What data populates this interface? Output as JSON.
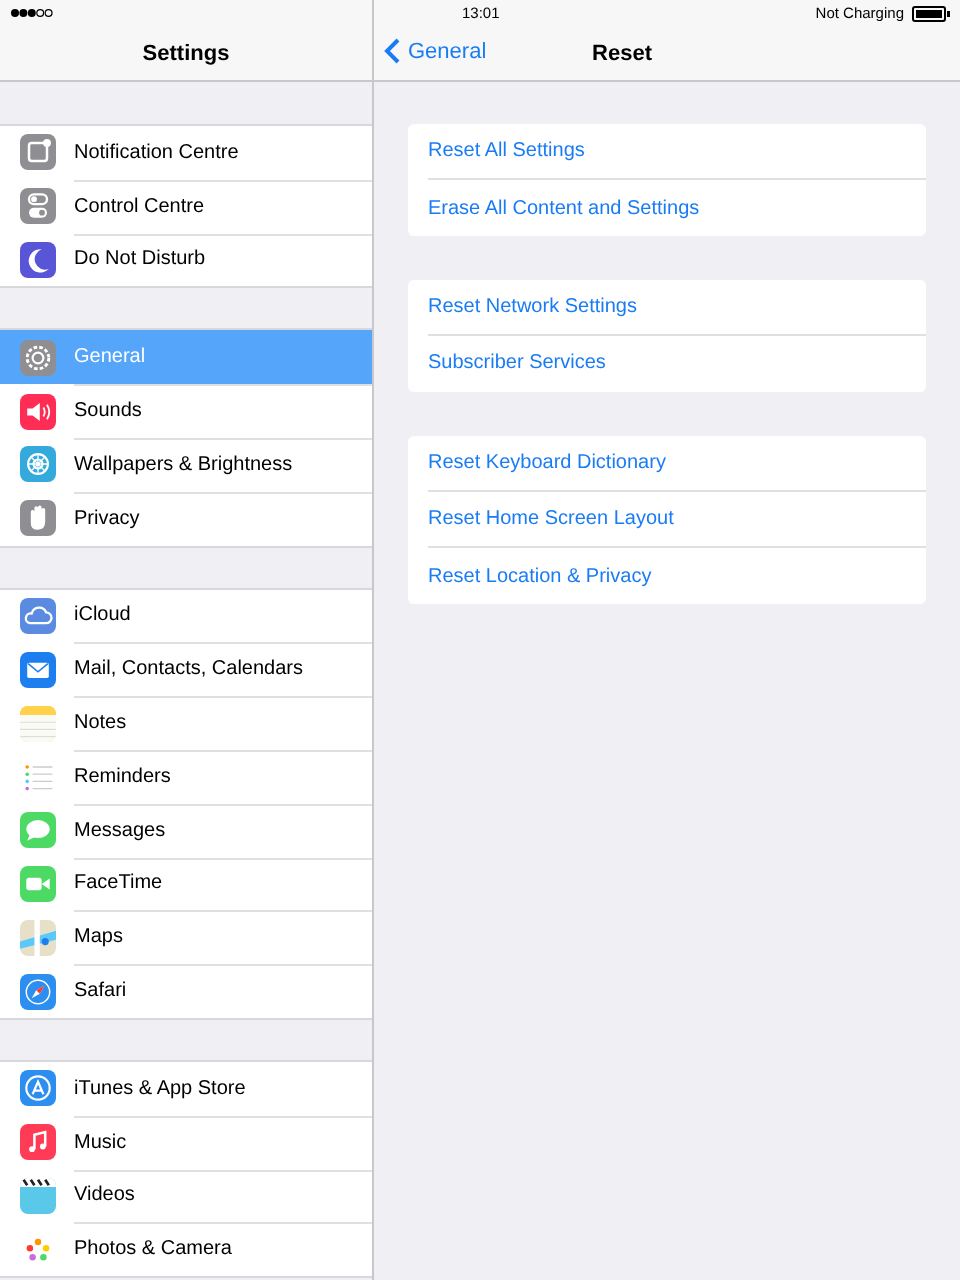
{
  "status_bar": {
    "time": "13:01",
    "battery_text": "Not Charging"
  },
  "sidebar": {
    "title": "Settings",
    "groups": [
      [
        {
          "label": "Notification Centre",
          "color": "#8e8e93",
          "selected": false
        },
        {
          "label": "Control Centre",
          "color": "#8e8e93",
          "selected": false
        },
        {
          "label": "Do Not Disturb",
          "color": "#5856d6",
          "selected": false
        }
      ],
      [
        {
          "label": "General",
          "color": "#8e8e93",
          "selected": true
        },
        {
          "label": "Sounds",
          "color": "#ff2d55",
          "selected": false
        },
        {
          "label": "Wallpapers & Brightness",
          "color": "#34aadc",
          "selected": false
        },
        {
          "label": "Privacy",
          "color": "#8e8e93",
          "selected": false
        }
      ],
      [
        {
          "label": "iCloud",
          "color": "#5a8be0",
          "selected": false
        },
        {
          "label": "Mail, Contacts, Calendars",
          "color": "#1d7ef0",
          "selected": false
        },
        {
          "label": "Notes",
          "color": "#ffd24a",
          "selected": false
        },
        {
          "label": "Reminders",
          "color": "#ffffff",
          "selected": false
        },
        {
          "label": "Messages",
          "color": "#4cd964",
          "selected": false
        },
        {
          "label": "FaceTime",
          "color": "#4cd964",
          "selected": false
        },
        {
          "label": "Maps",
          "color": "#e6e0c8",
          "selected": false
        },
        {
          "label": "Safari",
          "color": "#2c8ff0",
          "selected": false
        }
      ],
      [
        {
          "label": "iTunes & App Store",
          "color": "#2c8ff0",
          "selected": false
        },
        {
          "label": "Music",
          "color": "#ff3b55",
          "selected": false
        },
        {
          "label": "Videos",
          "color": "#5ac8e8",
          "selected": false
        },
        {
          "label": "Photos & Camera",
          "color": "#ffffff",
          "selected": false
        }
      ]
    ]
  },
  "detail": {
    "back": "General",
    "title": "Reset",
    "groups": [
      [
        "Reset All Settings",
        "Erase All Content and Settings"
      ],
      [
        "Reset Network Settings",
        "Subscriber Services"
      ],
      [
        "Reset Keyboard Dictionary",
        "Reset Home Screen Layout",
        "Reset Location & Privacy"
      ]
    ]
  }
}
